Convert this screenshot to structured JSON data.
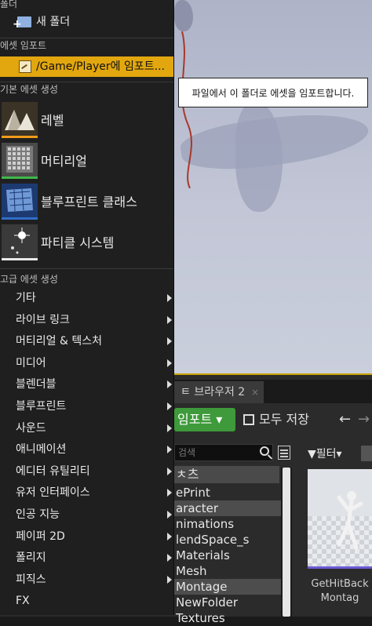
{
  "tooltip": {
    "text": "파일에서 이 폴더로 에셋을 임포트합니다."
  },
  "menu": {
    "section_folder": "폴더",
    "new_folder": "새 폴더",
    "section_import": "에셋 임포트",
    "import_to": "/Game/Player에 임포트...",
    "section_basic": "기본 에셋 생성",
    "basic_items": [
      {
        "label": "레벨",
        "icon": "level-icon",
        "accent": "#f09a1a"
      },
      {
        "label": "머티리얼",
        "icon": "material-icon",
        "accent": "#3fb74a"
      },
      {
        "label": "블루프린트 클래스",
        "icon": "blueprint-icon",
        "accent": "#2f6ec8"
      },
      {
        "label": "파티클 시스템",
        "icon": "particle-icon",
        "accent": "#e8e8e8"
      }
    ],
    "section_advanced": "고급 에셋 생성",
    "advanced_items": [
      {
        "label": "기타"
      },
      {
        "label": "라이브 링크"
      },
      {
        "label": "머티리얼 & 텍스처"
      },
      {
        "label": "미디어"
      },
      {
        "label": "블렌더블"
      },
      {
        "label": "블루프린트"
      },
      {
        "label": "사운드"
      },
      {
        "label": "애니메이션"
      },
      {
        "label": "에디터 유틸리티"
      },
      {
        "label": "유저 인터페이스"
      },
      {
        "label": "인공 지능"
      },
      {
        "label": "페이퍼 2D"
      },
      {
        "label": "폴리지"
      },
      {
        "label": "피직스"
      },
      {
        "label": "FX"
      }
    ]
  },
  "content_browser": {
    "tab_label": "ㅌ 브라우저 2",
    "tab_close": "×",
    "import_button": "임포트 ▾",
    "save_all_button": "모두 저장",
    "back_arrow": "←",
    "forward_arrow": "→",
    "search_placeholder": "검색",
    "filter_button": "▼필터▾",
    "tree_header": "ㅊ츠",
    "tree_items": [
      {
        "label": "ePrint",
        "selected": false
      },
      {
        "label": "aracter",
        "selected": true
      },
      {
        "label": "nimations",
        "selected": false
      },
      {
        "label": "lendSpace_s",
        "selected": false
      },
      {
        "label": "Materials",
        "selected": false
      },
      {
        "label": "Mesh",
        "selected": false
      },
      {
        "label": "Montage",
        "selected": true
      },
      {
        "label": "NewFolder",
        "selected": false
      },
      {
        "label": "Textures",
        "selected": false
      }
    ],
    "asset": {
      "caption_line1": "GetHitBack",
      "caption_line2": "Montag",
      "accent": "#6a5cd6"
    }
  },
  "colors": {
    "highlight": "#e2a70f",
    "import_green": "#3e9a3a",
    "menu_bg": "#1f1f1f"
  }
}
